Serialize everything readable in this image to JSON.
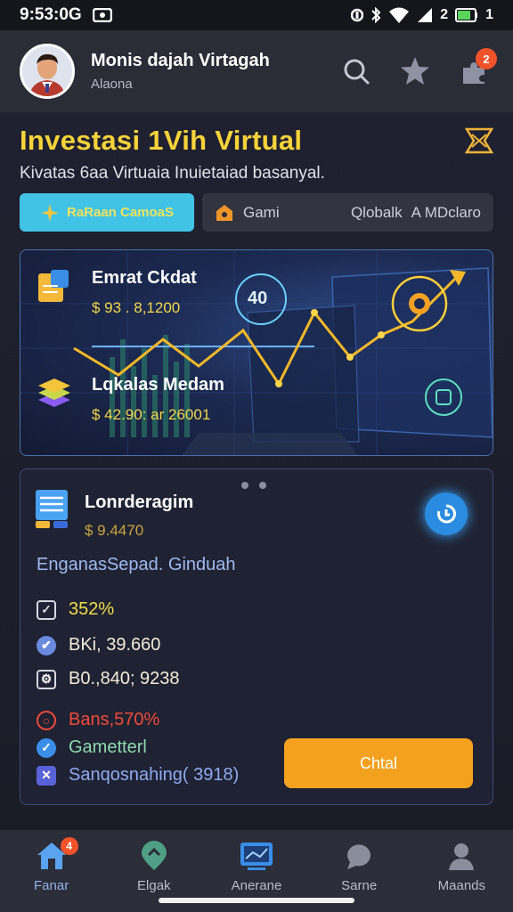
{
  "status_bar": {
    "time": "9:53:0G",
    "battery": "2",
    "battery_suffix": "1"
  },
  "header": {
    "user_name": "Monis dajah Virtagah",
    "user_sub": "Alaona",
    "notification_count": "2"
  },
  "page": {
    "title": "Investasi 1Vih Virtual",
    "subtitle": "Kivatas 6aa Virtuaia Inuietaiad basanyal."
  },
  "tabs": {
    "active_label": "RaRaan CamoaS",
    "second_label": "Gami",
    "third_label": "Qlobalk",
    "fourth_label": "A MDclaro"
  },
  "hero": {
    "chart_badge": "40",
    "item1_label": "Emrat Ckdat",
    "item1_value": "$ 93 . 8,1200",
    "item2_label": "Lqkalas Medam",
    "item2_value": "$ 42.90: ar 26001"
  },
  "card": {
    "title": "Lonrderagim",
    "value": "$ 9.4470",
    "section": "EnganasSepad. Ginduah",
    "stats": [
      {
        "text": "352%",
        "color": "#f2dd4b"
      },
      {
        "text": "BKi, 39.660",
        "color": "#f0ecd9"
      },
      {
        "text": "B0.,840; 9238",
        "color": "#f0ecd9"
      },
      {
        "text": "Bans,570%",
        "color": "#f04a3a"
      },
      {
        "text": "Gametterl",
        "color": "#8fd9b0"
      },
      {
        "text": "Sanqosnahing( 3918)",
        "color": "#8fa9f0"
      }
    ],
    "cta_label": "Chtal"
  },
  "bottom_nav": {
    "items": [
      {
        "label": "Fanar",
        "badge": "4"
      },
      {
        "label": "Elgak"
      },
      {
        "label": "Anerane"
      },
      {
        "label": "Sarne"
      },
      {
        "label": "Maands"
      }
    ]
  },
  "colors": {
    "accent_yellow": "#f6d33b",
    "accent_cyan": "#41c3e6",
    "accent_orange": "#f3a11f",
    "danger": "#f04a3a"
  }
}
